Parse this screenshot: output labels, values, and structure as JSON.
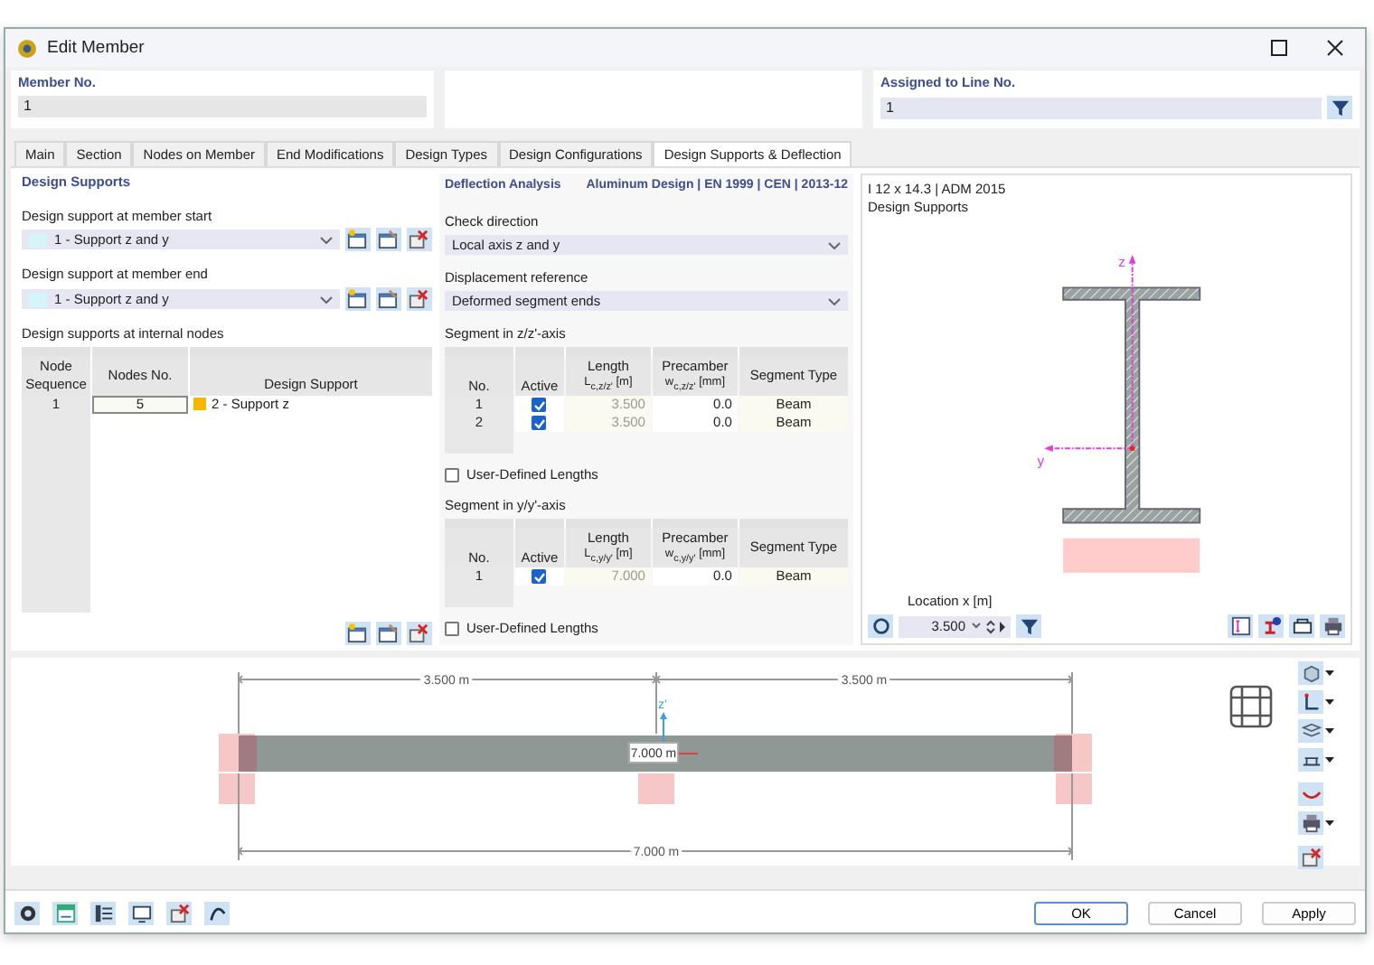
{
  "window": {
    "title": "Edit Member"
  },
  "member_no": {
    "label": "Member No.",
    "value": "1"
  },
  "assigned_to_line": {
    "label": "Assigned to Line No.",
    "value": "1"
  },
  "tabs": [
    {
      "label": "Main",
      "selected": false
    },
    {
      "label": "Section",
      "selected": false
    },
    {
      "label": "Nodes on Member",
      "selected": false
    },
    {
      "label": "End Modifications",
      "selected": false
    },
    {
      "label": "Design Types",
      "selected": false
    },
    {
      "label": "Design Configurations",
      "selected": false
    },
    {
      "label": "Design Supports & Deflection",
      "selected": true
    }
  ],
  "design_supports": {
    "title": "Design Supports",
    "start": {
      "label": "Design support at member start",
      "value": "1 - Support z and y",
      "color": "#d4f6fb"
    },
    "end": {
      "label": "Design support at member end",
      "value": "1 - Support z and y",
      "color": "#d4f6fb"
    },
    "internal": {
      "label": "Design supports at internal nodes",
      "columns": [
        "Node Sequence",
        "Nodes No.",
        "Design Support"
      ],
      "rows": [
        {
          "sequence": "1",
          "node": "5",
          "support": "2 - Support z",
          "color": "#f5b800"
        }
      ]
    }
  },
  "deflection": {
    "title": "Deflection Analysis",
    "standard": "Aluminum Design | EN 1999 | CEN | 2013-12",
    "check_direction": {
      "label": "Check direction",
      "value": "Local axis z and y"
    },
    "displacement_reference": {
      "label": "Displacement reference",
      "value": "Deformed segment ends"
    },
    "segments": [
      {
        "title": "Segment in z/z'-axis",
        "columns": [
          "No.",
          "Active",
          "Length",
          "L$_{c,z/z'}$ [m]",
          "Precamber",
          "w$_{c,z/z'}$ [mm]",
          "Segment Type"
        ],
        "rows": [
          {
            "no": "1",
            "active": true,
            "length": "3.500",
            "precamber": "0.0",
            "type": "Beam"
          },
          {
            "no": "2",
            "active": true,
            "length": "3.500",
            "precamber": "0.0",
            "type": "Beam"
          }
        ],
        "user_defined": {
          "label": "User-Defined Lengths",
          "checked": false
        }
      },
      {
        "title": "Segment in y/y'-axis",
        "columns": [
          "No.",
          "Active",
          "Length",
          "L$_{c,y/y'}$ [m]",
          "Precamber",
          "w$_{c,y/y'}$ [mm]",
          "Segment Type"
        ],
        "rows": [
          {
            "no": "1",
            "active": true,
            "length": "7.000",
            "precamber": "0.0",
            "type": "Beam"
          }
        ],
        "user_defined": {
          "label": "User-Defined Lengths",
          "checked": false
        }
      }
    ]
  },
  "section_preview": {
    "title": "I 12 x 14.3 | ADM 2015",
    "subtitle": "Design Supports",
    "axis_z": "z",
    "axis_y": "y",
    "location": {
      "label": "Location x [m]",
      "value": "3.500"
    }
  },
  "member_view": {
    "spans": [
      "3.500 m",
      "3.500 m"
    ],
    "total": "7.000 m",
    "marker": "7.000 m",
    "axis_z": "z'"
  },
  "buttons": [
    {
      "label": "OK",
      "default": true
    },
    {
      "label": "Cancel",
      "default": false
    },
    {
      "label": "Apply",
      "default": false
    }
  ]
}
